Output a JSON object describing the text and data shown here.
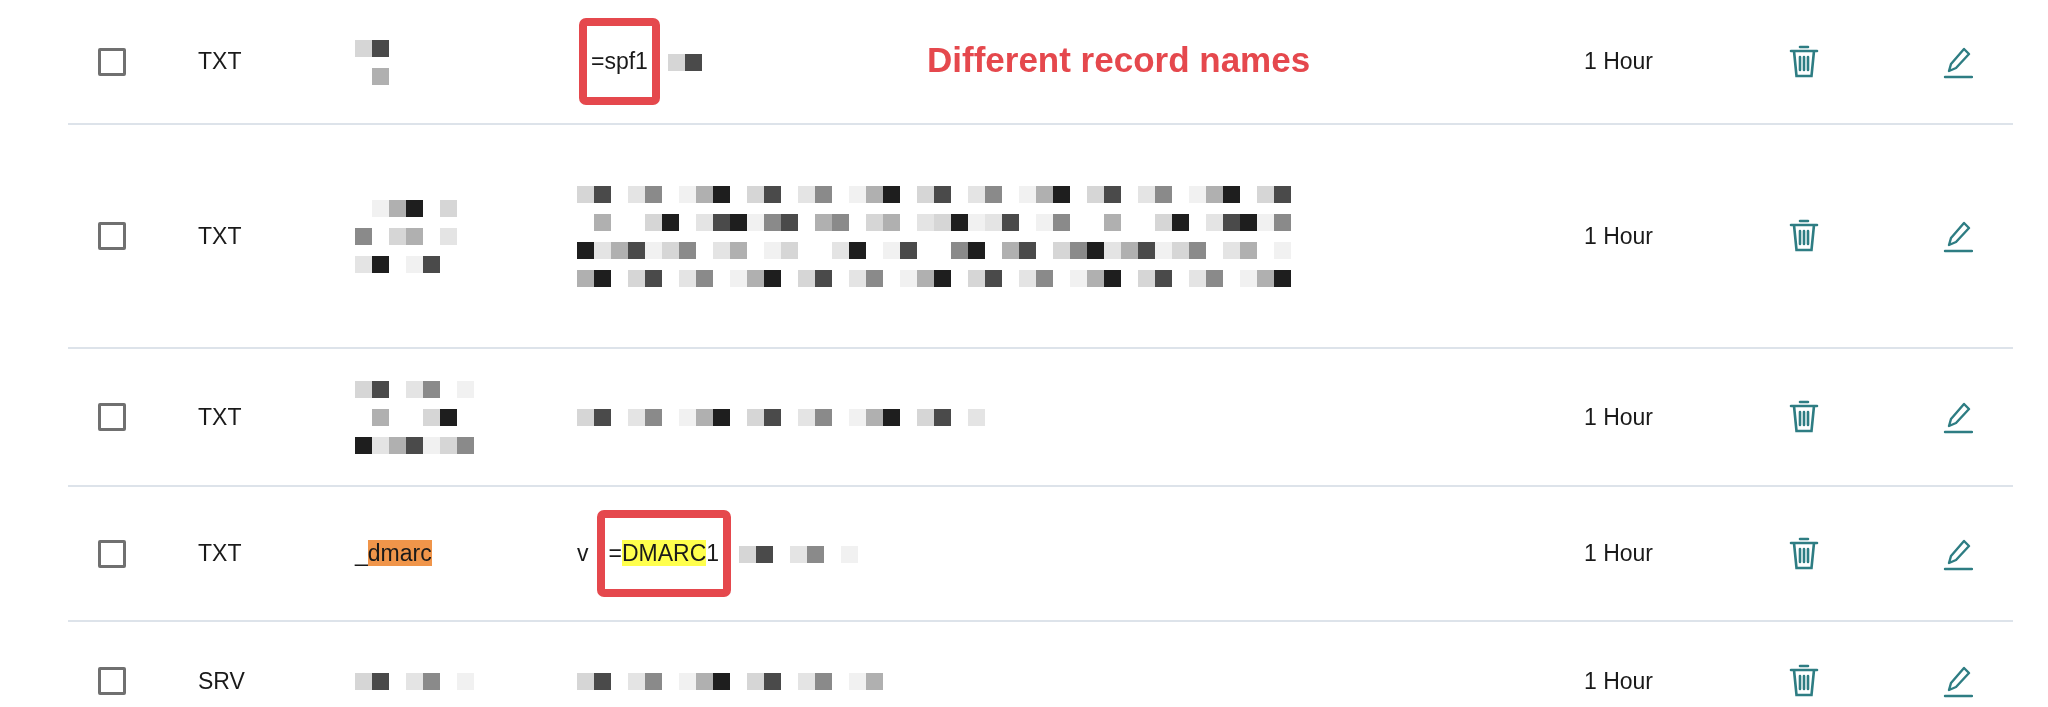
{
  "annotation": {
    "text": "Different record names"
  },
  "rows": [
    {
      "checked": false,
      "type": "TXT",
      "name": [],
      "value": [
        {
          "text": "=spf1",
          "boxed": true
        }
      ],
      "ttl": "1 Hour"
    },
    {
      "checked": false,
      "type": "TXT",
      "name": [],
      "value": [],
      "ttl": "1 Hour"
    },
    {
      "checked": false,
      "type": "TXT",
      "name": [],
      "value": [],
      "ttl": "1 Hour"
    },
    {
      "checked": false,
      "type": "TXT",
      "name": [
        {
          "text": "_"
        },
        {
          "text": "dmarc",
          "color": "#f0954a"
        }
      ],
      "value": [
        {
          "text": "v"
        },
        {
          "text": "=",
          "boxed": true
        },
        {
          "text": "DMARC",
          "boxed": true,
          "color": "#ffff4d"
        },
        {
          "text": "1",
          "boxed": true
        }
      ],
      "ttl": "1 Hour"
    },
    {
      "checked": false,
      "type": "SRV",
      "name": [],
      "value": [],
      "ttl": "1 Hour"
    }
  ]
}
